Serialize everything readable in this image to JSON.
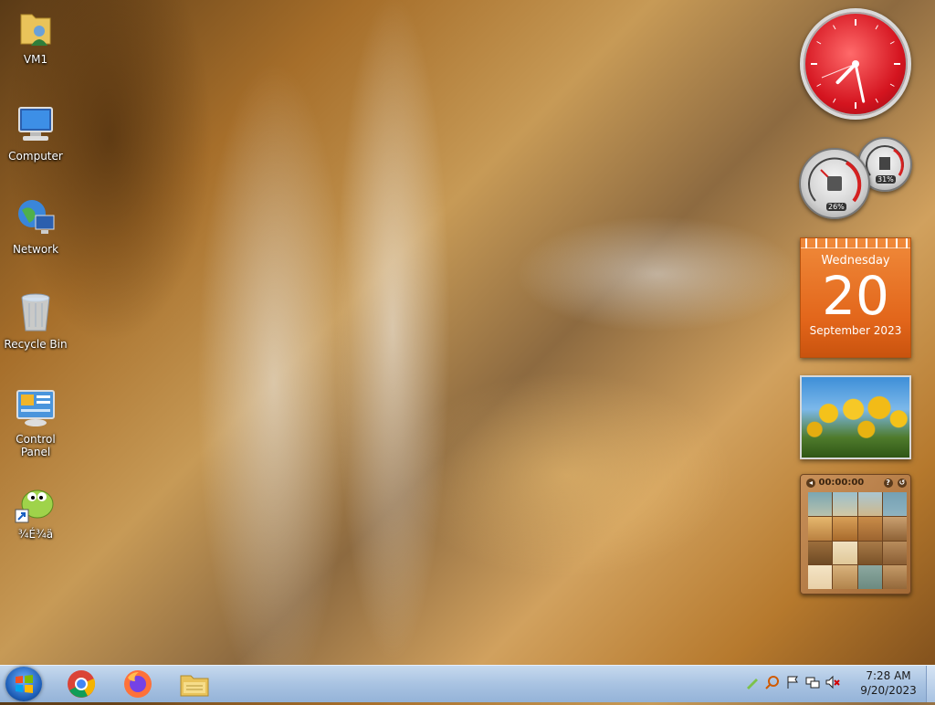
{
  "desktop": {
    "icons": [
      {
        "label": "VM1",
        "icon": "user-folder-icon"
      },
      {
        "label": "Computer",
        "icon": "computer-icon"
      },
      {
        "label": "Network",
        "icon": "network-icon"
      },
      {
        "label": "Recycle Bin",
        "icon": "recycle-bin-icon"
      },
      {
        "label": "Control Panel",
        "icon": "control-panel-icon"
      },
      {
        "label": "¾É¾ä",
        "icon": "shortcut-app-icon"
      }
    ]
  },
  "gadgets": {
    "clock": {
      "hour": 7,
      "minute": 28
    },
    "cpu_meter": {
      "cpu_label": "26%",
      "memory_label": "31%",
      "cpu": 26,
      "memory": 31
    },
    "calendar": {
      "weekday": "Wednesday",
      "day": "20",
      "month_year": "September 2023"
    },
    "slideshow": {
      "subject": "tulips"
    },
    "puzzle": {
      "timer": "00:00:00",
      "help": "?"
    }
  },
  "taskbar": {
    "apps": [
      {
        "name": "Chrome",
        "icon": "chrome-icon"
      },
      {
        "name": "Firefox",
        "icon": "firefox-icon"
      },
      {
        "name": "Windows Explorer",
        "icon": "explorer-folder-icon"
      }
    ],
    "time": "7:28 AM",
    "date": "9/20/2023"
  },
  "colors": {
    "taskbar": "#a9c3e2",
    "calendar": "#e2651a",
    "clock": "#d4141f"
  }
}
